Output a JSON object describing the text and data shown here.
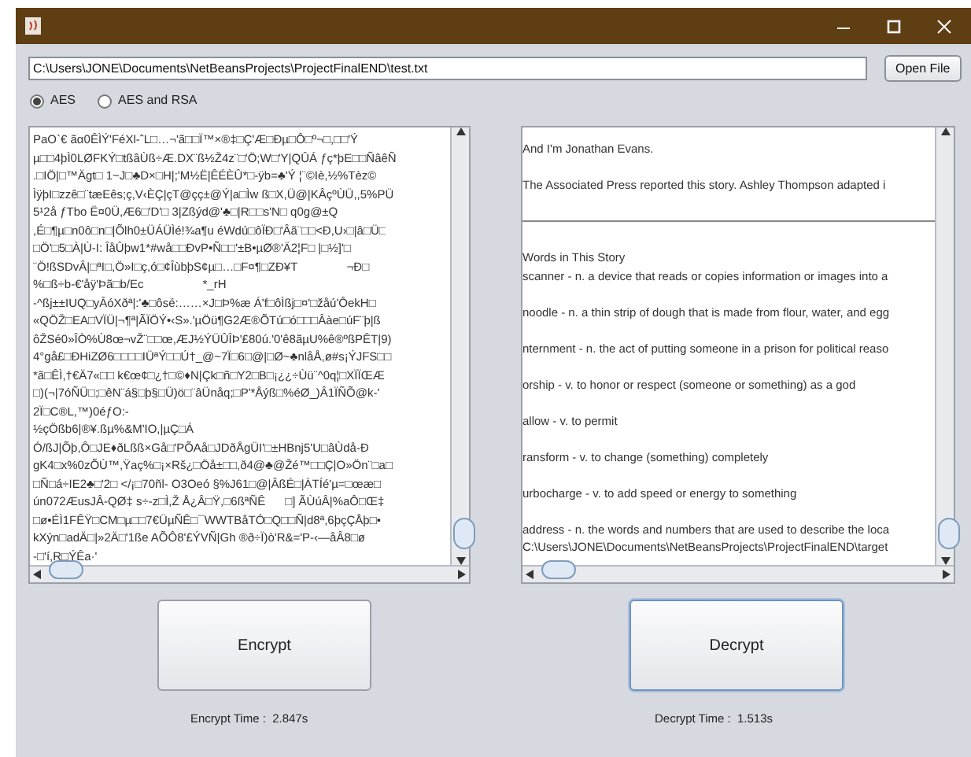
{
  "file_path": {
    "value": "C:\\Users\\JONE\\Documents\\NetBeansProjects\\ProjectFinalEND\\test.txt"
  },
  "open_button": "Open File",
  "modes": [
    {
      "label": "AES",
      "selected": true
    },
    {
      "label": "AES and RSA",
      "selected": false
    }
  ],
  "encrypted_text": [
    "PaO`€ ãα0ÊÌÝ'FéXl-ˆL□…¬'ã□□Ï™×®‡□Ç'Æ□Ðµ□Ô□º¬□,□□'Ý",
    "µ□□4þÌ0LØFKÝ□tßâÙß÷Æ.DX¨ß½Ž4z¨□'Ö;W□'Y|QÛÁ ƒç*þE□□ÑâêÑ",
    ".□IÖ|□™Ägt□ 1~J□♣D×□H|;'M½Ë|ÊÉÈÛ*□-ÿb=♣'Ý ¦¨©Iè,½%Tèz©",
    "ÌÿþI□zzê□¨tæEês;ç,V‹ÈÇ|çT@çç±@Ý|a□Ìw ß□X,Ü@|KÂçºÙÜ,,5%PÜ",
    "5¹2å ƒTbo Ë¤0Ü,Æ6□'D'□ 3|Zßýd@'♣□|R□□s'N□ q0g@±Q",
    ",É□¶µ□n0ô□n□|Õlh0±ÜÁÜÌé!¾a¶u éWdú□ôÏÐ□'Âã¨□□<Ð,U›□|â□Ü□",
    "□Ö'□5□À|Ù-I: ÎåÛþw1*#wå□□ÐvP•Ñ□□'±B•µØ®'Ä2¦F□ |□½]'□",
    "¨Ö!ßSDvÂ|□ªI□,Ö»I□ç,ó□¢ÎùbþS¢µ□…□F¤¶□ZÐ¥T               ¬Ð□",
    "%□ß÷b-€'åÿ'Þã□b/Ec                  *_rH",
    "-^ßj±±IUQ□yÂóXðª|:'♣□ôsé:……×J□Þ%æ Á'f□ôÌßj□¤'□žåú'ÔekH□",
    "«QÖŽ□EA□VÏÜ|¬¶ª|ÃÏÖÝ•‹S».'µÖü¶G2Æ®ÕTú□ó□□□Âàe□úF¨þ|ß",
    "ôŽSé0»ÎÒ%Ù8œ¬vŽ¨□□œ,ÆJ½ÝÜÛÎÞ'£80ú.'0'ê8ãµU%ê®ºßPÊT|9)",
    "4°gå£□ÐHiZØ6□□□□IÜªÝ□□Ú†_@~7Ï□6□@|□Ø~♣nlåÅ,ø#s¡ÝJFS□□",
    "*ã□ÊÌ,†€Ä7«□□ k€œ¢□¿†□©♦N|Çk□ñ□Y2□B□¡¿¿÷Ùü¨^0q¦□XÏÏŒÆ",
    "□)(¬|7óÑÜ□;□êN¨á§□þ§□Ü)ö□¨âÜnåq;□P'*Åýß□%éØ_)Â1ÏÑÕ@k-'",
    "2Ï□C®L,™)0éƒO:-",
    "½çÖßb6|®¥.ßµ%&M'IO,|µÇ□Á",
    "Ó/ßJ|Õþ,Ô□JE♦ðLßß×Gå□'PÕAå□JDðÅgÜI'□±HBnj5'U□âÙdå-Ð",
    "gK4□x%0zÕÙ™,Ÿaç%□¡×Rš¿□Öå±□□,ð4@♣@Žé™□□Ç|O»Ön¨□a□",
    "□Ñ□á÷IE2♣□'2□ </¡□70ñl- O3Oeó §%J61□@|ÂßÉ□|ÀTÍé'µ=□œæ□",
    "ún072ÆusJÂ-QØ‡ s÷-z□Ì,Ž Å¿Â□Ÿ,□6ßªÑÊ      □] ÃÙúÂ|%aÔ□Œ‡",
    "□ø•ÉÌ1FÊŸ□CM□µ□□7€ÜµÑÊ□¯WWTBåTÓ□Q□□Ñ|d8ª,6þçÇÅþ□•",
    "kXýn□adÄ□|»2Ä□'1ße AÕÔ8'£ÝVÑ|Gh ®ð÷Ï)ò'R&='P-‹—åÂ8□ø",
    "-□'í,R□ÝÊa·'"
  ],
  "decrypted_text": [
    {
      "kind": "text",
      "text": "And I'm Jonathan Evans."
    },
    {
      "kind": "blank"
    },
    {
      "kind": "text",
      "text": "The Associated Press reported this story. Ashley Thompson adapted i"
    },
    {
      "kind": "blank"
    },
    {
      "kind": "rule"
    },
    {
      "kind": "blank"
    },
    {
      "kind": "text",
      "text": "Words in This Story"
    },
    {
      "kind": "text",
      "text": "scanner - n. a device that reads or copies information or images into a"
    },
    {
      "kind": "blank"
    },
    {
      "kind": "text",
      "text": "noodle - n. a thin strip of dough that is made from flour, water, and egg"
    },
    {
      "kind": "blank"
    },
    {
      "kind": "text",
      "text": "nternment - n. the act of putting someone in a prison for political reaso"
    },
    {
      "kind": "blank"
    },
    {
      "kind": "text",
      "text": "orship - v. to honor or respect (someone or something) as a god"
    },
    {
      "kind": "blank"
    },
    {
      "kind": "text",
      "text": "allow - v. to permit"
    },
    {
      "kind": "blank"
    },
    {
      "kind": "text",
      "text": "ransform - v. to change (something) completely"
    },
    {
      "kind": "blank"
    },
    {
      "kind": "text",
      "text": "urbocharge - v. to add speed or energy to something"
    },
    {
      "kind": "blank"
    },
    {
      "kind": "text",
      "text": "address - n. the words and numbers that are used to describe the loca"
    },
    {
      "kind": "text",
      "text": "C:\\Users\\JONE\\Documents\\NetBeansProjects\\ProjectFinalEND\\target"
    }
  ],
  "encrypt_button": {
    "label": "Encrypt",
    "focused": false
  },
  "decrypt_button": {
    "label": "Decrypt",
    "focused": true
  },
  "encrypt_time": "Encrypt Time :  2.847s",
  "decrypt_time": "Decrypt Time :  1.513s"
}
